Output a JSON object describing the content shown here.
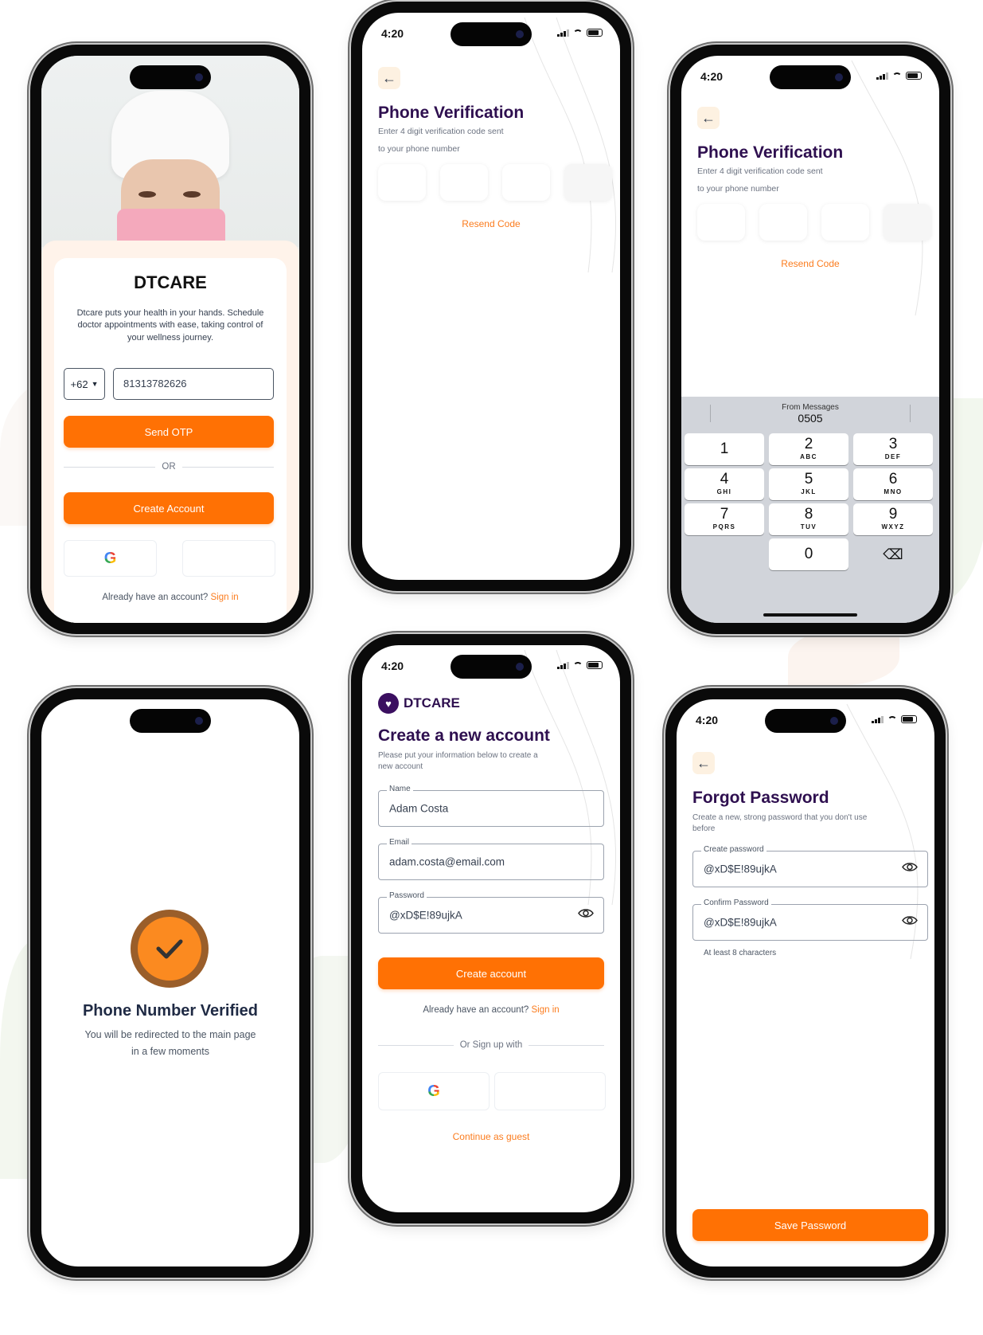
{
  "brand": {
    "name": "DTCARE",
    "primary_color": "#ff7104",
    "title_color": "#2e0f4f",
    "link_color": "#fb7c1e"
  },
  "status_bar": {
    "time": "4:20"
  },
  "screens": {
    "login": {
      "title": "DTCARE",
      "description": "Dtcare puts your health in your hands. Schedule doctor appointments with ease, taking control of your wellness journey.",
      "country_code": "+62",
      "phone_value": "81313782626",
      "send_otp_label": "Send OTP",
      "or_label": "OR",
      "create_account_label": "Create Account",
      "google_icon": "google-icon",
      "apple_icon": "apple-icon",
      "signin_prompt": "Already have an account?",
      "signin_link": "Sign in"
    },
    "verify_empty": {
      "title": "Phone Verification",
      "subtitle_line1": "Enter 4 digit verification code sent",
      "subtitle_line2": "to your phone number",
      "resend_label": "Resend Code"
    },
    "verify_keyboard": {
      "title": "Phone Verification",
      "subtitle_line1": "Enter 4 digit verification code sent",
      "subtitle_line2": "to your phone number",
      "resend_label": "Resend Code",
      "suggestion_source": "From Messages",
      "suggestion_code": "0505",
      "keys": [
        {
          "num": "1",
          "letters": ""
        },
        {
          "num": "2",
          "letters": "ABC"
        },
        {
          "num": "3",
          "letters": "DEF"
        },
        {
          "num": "4",
          "letters": "GHI"
        },
        {
          "num": "5",
          "letters": "JKL"
        },
        {
          "num": "6",
          "letters": "MNO"
        },
        {
          "num": "7",
          "letters": "PQRS"
        },
        {
          "num": "8",
          "letters": "TUV"
        },
        {
          "num": "9",
          "letters": "WXYZ"
        },
        {
          "num": "0",
          "letters": ""
        }
      ]
    },
    "verified": {
      "title": "Phone Number Verified",
      "message_line1": "You will be redirected to the main page",
      "message_line2": "in a few moments"
    },
    "signup": {
      "brand_name": "DTCARE",
      "title": "Create a new account",
      "subtitle": "Please put your information below to create a new account",
      "name_label": "Name",
      "name_value": "Adam Costa",
      "email_label": "Email",
      "email_value": "adam.costa@email.com",
      "password_label": "Password",
      "password_value": "@xD$E!89ujkA",
      "create_label": "Create account",
      "signin_prompt": "Already have an account?",
      "signin_link": "Sign in",
      "or_signup_label": "Or Sign up with",
      "guest_label": "Continue as guest"
    },
    "forgot": {
      "title": "Forgot Password",
      "subtitle": "Create a new, strong password that you don't use before",
      "create_label": "Create password",
      "create_value": "@xD$E!89ujkA",
      "confirm_label": "Confirm Password",
      "confirm_value": "@xD$E!89ujkA",
      "hint": "At least 8 characters",
      "save_label": "Save Password"
    }
  }
}
